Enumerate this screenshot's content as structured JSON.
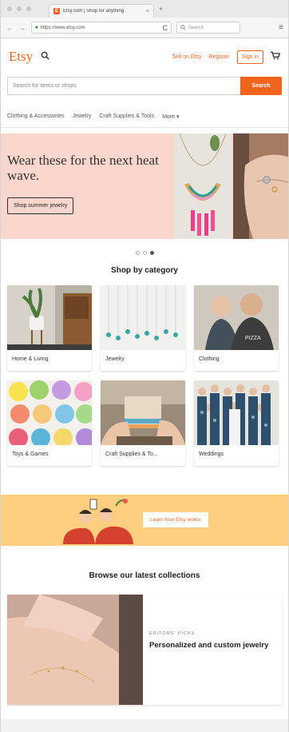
{
  "browser": {
    "tab_title": "Etsy.com | Shop for anything",
    "tab_close": "×",
    "new_tab": "+",
    "url": "https://www.etsy.com",
    "search_placeholder": "Search",
    "back": "←",
    "forward": "→",
    "reload": "C",
    "menu": "≡"
  },
  "header": {
    "logo": "Etsy",
    "sell": "Sell on Etsy",
    "register": "Register",
    "signin": "Sign in"
  },
  "search": {
    "placeholder": "Search for items or shops",
    "button": "Search"
  },
  "nav": {
    "items": [
      "Clothing & Accessories",
      "Jewelry",
      "Craft Supplies & Tools",
      "More ▾"
    ]
  },
  "hero": {
    "headline": "Wear these for the next heat wave.",
    "cta": "Shop summer jewelry"
  },
  "categories": {
    "title": "Shop by category",
    "items": [
      {
        "label": "Home & Living"
      },
      {
        "label": "Jewelry"
      },
      {
        "label": "Clothing"
      },
      {
        "label": "Toys & Games"
      },
      {
        "label": "Craft Supplies & To..."
      },
      {
        "label": "Weddings"
      }
    ]
  },
  "banner": {
    "button": "Learn how Etsy works"
  },
  "collections": {
    "title": "Browse our latest collections",
    "kicker": "EDITORS' PICKS",
    "card_title": "Personalized and custom jewelry"
  },
  "colors": {
    "accent": "#f1641e",
    "hero_bg": "#fbd6cd",
    "banner_bg": "#fdcf7f"
  }
}
